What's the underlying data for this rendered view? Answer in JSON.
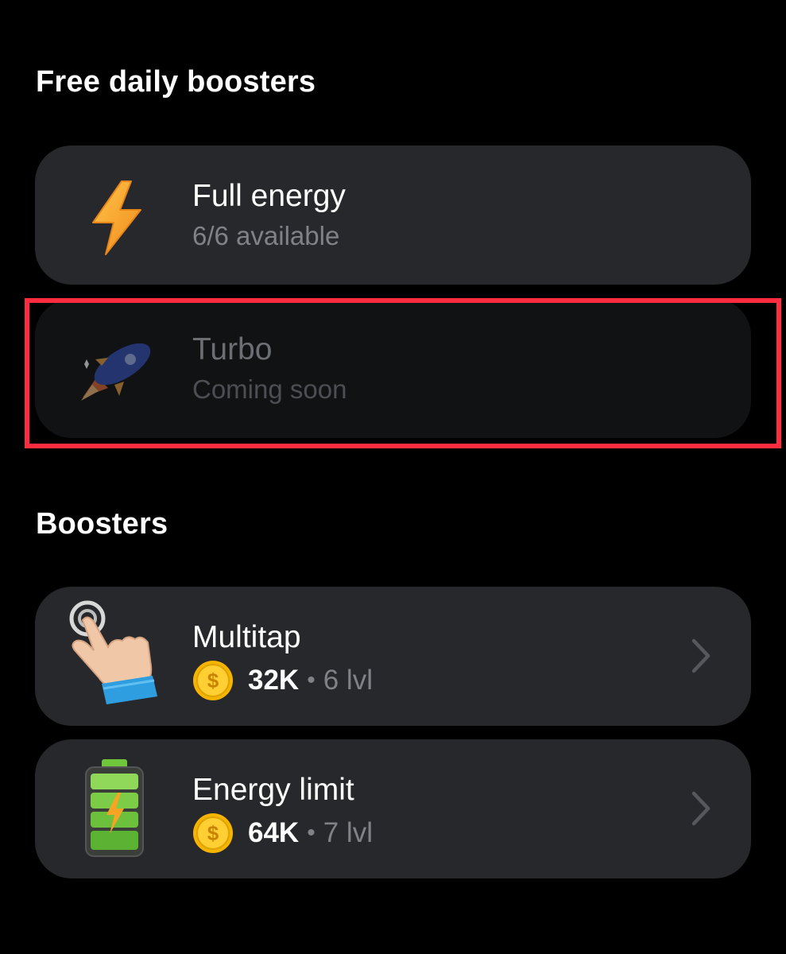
{
  "free_section": {
    "title": "Free daily boosters",
    "items": [
      {
        "title": "Full energy",
        "subtitle": "6/6 available",
        "icon": "lightning-bolt-icon",
        "state": "enabled"
      },
      {
        "title": "Turbo",
        "subtitle": "Coming soon",
        "icon": "rocket-icon",
        "state": "disabled"
      }
    ]
  },
  "boosters_section": {
    "title": "Boosters",
    "items": [
      {
        "title": "Multitap",
        "price": "32K",
        "separator": "•",
        "level": "6 lvl",
        "icon": "tap-hand-icon"
      },
      {
        "title": "Energy limit",
        "price": "64K",
        "separator": "•",
        "level": "7 lvl",
        "icon": "battery-icon"
      }
    ]
  },
  "colors": {
    "background": "#000000",
    "card": "#27282c",
    "card_disabled": "#111214",
    "highlight": "#ff2b3f",
    "coin": "#f5b400",
    "bolt": "#f7a323"
  }
}
